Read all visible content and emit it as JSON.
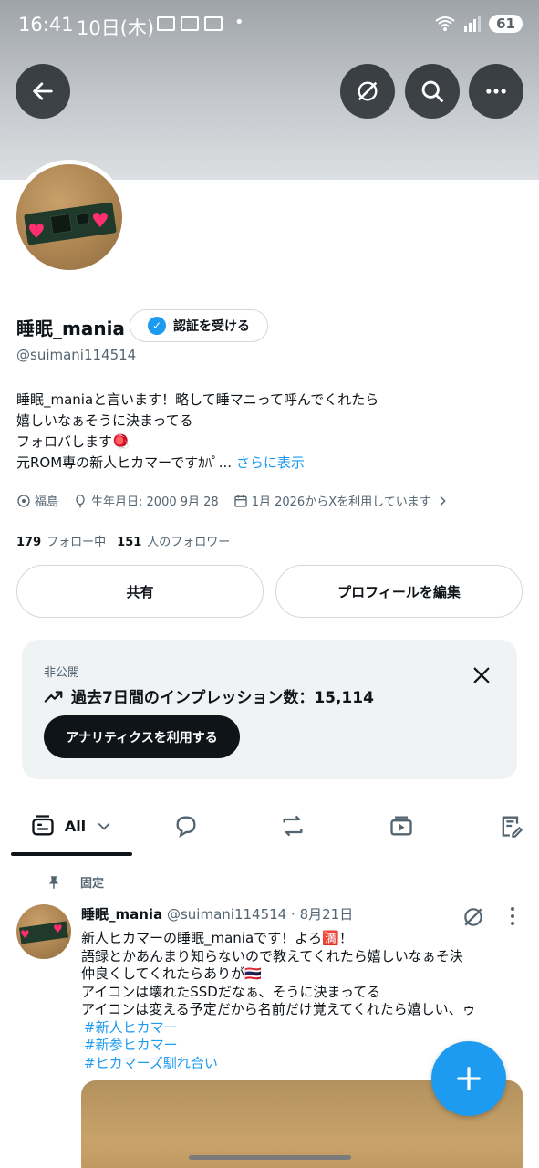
{
  "status_bar": {
    "time": "16:41",
    "date": "10日(木)",
    "dot": "•",
    "battery": "61"
  },
  "profile": {
    "name": "睡眠_mania",
    "verify_label": "認証を受ける",
    "handle": "@suimani114514",
    "bio_lines": [
      "睡眠_maniaと言います！略して睡マニって呼んでくれたら",
      "嬉しいなぁそうに決まってる",
      "フォロバします🪀",
      "元ROM専の新人ヒカマーですｶﾊﾟ..."
    ],
    "bio_more": "さらに表示",
    "location": "福島",
    "birthday": "生年月日: 2000 9月 28",
    "joined": "1月 2026からXを利用しています",
    "following_count": "179",
    "following_label": "フォロー中",
    "followers_count": "151",
    "followers_label": "人のフォロワー"
  },
  "buttons": {
    "share": "共有",
    "edit_profile": "プロフィールを編集"
  },
  "analytics": {
    "private_label": "非公開",
    "impressions": "過去7日間のインプレッション数：15,114",
    "cta": "アナリティクスを利用する"
  },
  "tabs": {
    "all_label": "All"
  },
  "pinned_post": {
    "pinned_label": "固定",
    "author_name": "睡眠_mania",
    "author_handle": "@suimani114514",
    "separator": "·",
    "date": "8月21日",
    "lines": [
      "新人ヒカマーの睡眠_maniaです！よろ🈵！",
      "語録とかあんまり知らないので教えてくれたら嬉しいなぁそ決",
      "仲良くしてくれたらありが🇹🇭",
      "アイコンは壊れたSSDだなぁ、そうに決まってる",
      "アイコンは変える予定だから名前だけ覚えてくれたら嬉しい、ゥ"
    ],
    "hashtags": [
      "#新人ヒカマー",
      "#新参ヒカマー",
      "#ヒカマーズ馴れ合い"
    ]
  },
  "colors": {
    "accent": "#1d9bf0",
    "text": "#0f1419",
    "secondary": "#536471"
  }
}
